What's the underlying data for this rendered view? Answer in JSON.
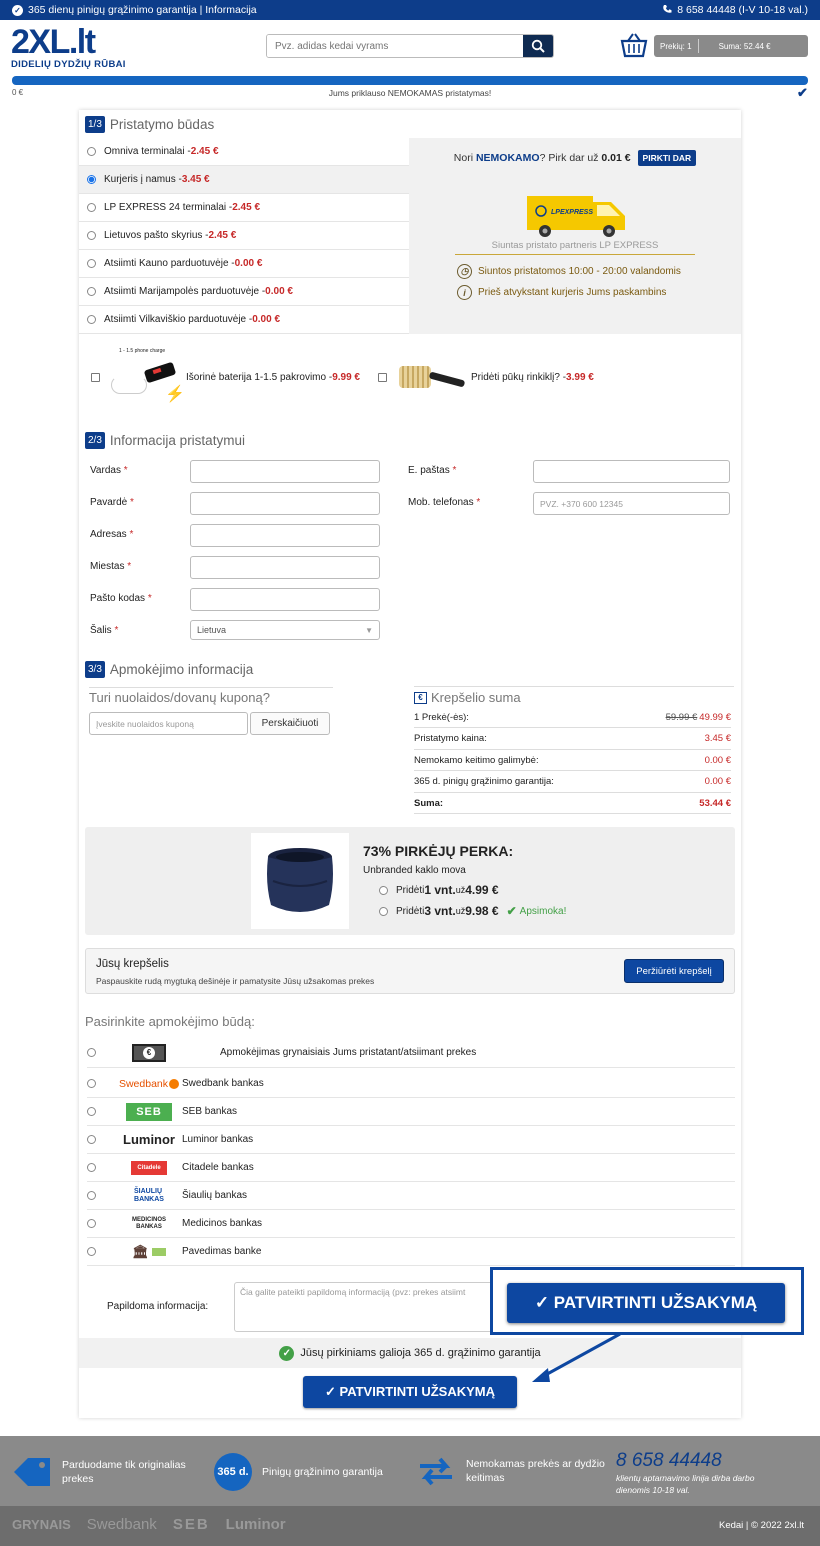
{
  "topbar": {
    "guarantee_text": "365 dienų pinigų grąžinimo garantija | Informacija",
    "phone": "8 658 44448 (I-V 10-18 val.)"
  },
  "header": {
    "logo_main": "2XL.lt",
    "logo_sub": "DIDELIŲ DYDŽIŲ RŪBAI",
    "search_placeholder": "Pvz. adidas kedai vyrams",
    "cart_items": "Prekių: 1",
    "cart_sum": "Suma: 52.44 €"
  },
  "progress": {
    "left_label": "0 €",
    "message": "Jums priklauso NEMOKAMAS pristatymas!",
    "fill_percent": 100
  },
  "step1": {
    "num": "1/3",
    "title": "Pristatymo būdas",
    "options": [
      {
        "label": "Omniva terminalai - ",
        "price": "2.45 €"
      },
      {
        "label": "Kurjeris į namus - ",
        "price": "3.45 €"
      },
      {
        "label": "LP EXPRESS 24 terminalai - ",
        "price": "2.45 €"
      },
      {
        "label": "Lietuvos pašto skyrius - ",
        "price": "2.45 €"
      },
      {
        "label": "Atsiimti Kauno parduotuvėje - ",
        "price": "0.00 €"
      },
      {
        "label": "Atsiimti Marijampolės parduotuvėje - ",
        "price": "0.00 €"
      },
      {
        "label": "Atsiimti Vilkaviškio parduotuvėje - ",
        "price": "0.00 €"
      }
    ],
    "free_pre": "Nori ",
    "free_bold": "NEMOKAMO",
    "free_mid": "? Pirk dar už ",
    "free_amount": "0.01 €",
    "buy_button": "PIRKTI DAR",
    "van_logo": "LPEXPRESS",
    "partner_text": "Siuntas pristato partneris LP EXPRESS",
    "time_text": "Siuntos pristatomos 10:00 - 20:00 valandomis",
    "call_text": "Prieš atvykstant kurjeris Jums paskambins",
    "addon1_caption": "1 - 1.5 phone charge",
    "addon1_label": "Išorinė baterija 1-1.5 pakrovimo - ",
    "addon1_price": "9.99 €",
    "addon2_label": "Pridėti pūkų rinkiklį? - ",
    "addon2_price": "3.99 €"
  },
  "step2": {
    "num": "2/3",
    "title": "Informacija pristatymui",
    "fields_left": [
      "Vardas",
      "Pavardė",
      "Adresas",
      "Miestas",
      "Pašto kodas",
      "Šalis"
    ],
    "fields_right": [
      "E. paštas",
      "Mob. telefonas"
    ],
    "phone_placeholder": "PVZ. +370 600 12345",
    "country_value": "Lietuva",
    "required_mark": "*"
  },
  "step3": {
    "num": "3/3",
    "title": "Apmokėjimo informacija",
    "coupon_title": "Turi nuolaidos/dovanų kuponą?",
    "coupon_placeholder": "Įveskite nuolaidos kuponą",
    "recalc_button": "Perskaičiuoti",
    "summary_title": "Krepšelio suma",
    "summary_rows": [
      {
        "label": "1 Prekė(-ės):",
        "old": "59.99 €",
        "value": "49.99 €"
      },
      {
        "label": "Pristatymo kaina:",
        "old": "",
        "value": "3.45 €"
      },
      {
        "label": "Nemokamo keitimo galimybė:",
        "old": "",
        "value": "0.00 €"
      },
      {
        "label": "365 d. pinigų grąžinimo garantija:",
        "old": "",
        "value": "0.00 €"
      },
      {
        "label": "Suma:",
        "old": "",
        "value": "53.44 €"
      }
    ]
  },
  "upsell": {
    "headline": "73% PIRKĖJŲ PERKA:",
    "product": "Unbranded kaklo mova",
    "opt1_pre": "Pridėti ",
    "opt1_qty": "1 vnt.",
    "opt1_mid": " už ",
    "opt1_price": "4.99 €",
    "opt2_pre": "Pridėti ",
    "opt2_qty": "3 vnt.",
    "opt2_mid": " už ",
    "opt2_price": "9.98 €",
    "opt2_badge": "Apsimoka!"
  },
  "cart": {
    "title": "Jūsų krepšelis",
    "desc": "Paspauskite rudą mygtuką dešinėje ir pamatysite Jūsų užsakomas prekes",
    "button": "Peržiūrėti krepšelį"
  },
  "payment": {
    "title": "Pasirinkite apmokėjimo būdą:",
    "methods": [
      {
        "logo": "€",
        "label": "Apmokėjimas grynaisiais Jums pristatant/atsiimant prekes"
      },
      {
        "logo": "Swedbank",
        "label": "Swedbank bankas"
      },
      {
        "logo": "SEB",
        "label": "SEB bankas"
      },
      {
        "logo": "Luminor",
        "label": "Luminor bankas"
      },
      {
        "logo": "Citadele",
        "label": "Citadele bankas"
      },
      {
        "logo": "ŠIAULIŲ BANKAS",
        "label": "Šiaulių bankas"
      },
      {
        "logo": "MEDICINOS BANKAS",
        "label": "Medicinos bankas"
      },
      {
        "logo": "",
        "label": "Pavedimas banke"
      }
    ],
    "extra_label": "Papildoma informacija:",
    "extra_placeholder": "Čia galite pateikti papildomą informaciją (pvz: prekes atsiimt",
    "guarantee": "Jūsų pirkiniams galioja 365 d. grąžinimo garantija",
    "confirm_button": "✓ PATVIRTINTI UŽSAKYMĄ"
  },
  "footer": {
    "f1": "Parduodame tik originalias prekes",
    "badge": "365 d.",
    "f2": "Pinigų grąžinimo garantija",
    "f3": "Nemokamas prekės ar dydžio keitimas",
    "phone": "8 658 44448",
    "phone_note": "klientų aptarnavimo linija dirba darbo dienomis 10-18 val.",
    "payment_logos": [
      "GRYNAIS",
      "Swedbank",
      "SEB",
      "Luminor"
    ],
    "links": "Kedai | © 2022 2xl.lt"
  }
}
